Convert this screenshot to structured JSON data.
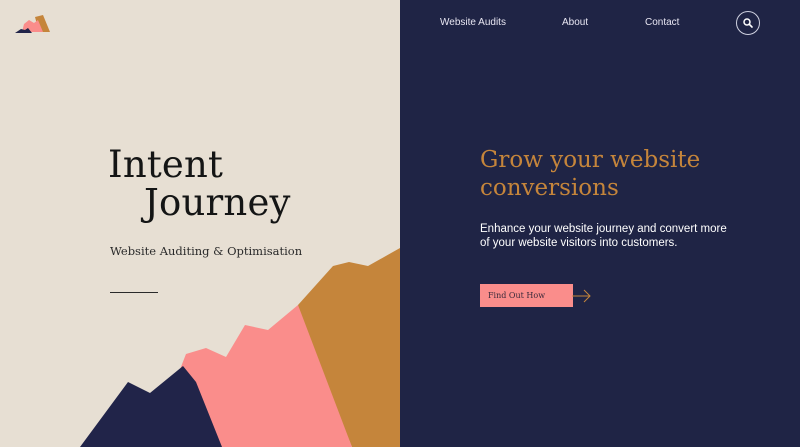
{
  "brand": {
    "title_line1": "Intent",
    "title_line2": "Journey",
    "subtitle": "Website Auditing & Optimisation",
    "logo_icon": "mountain-logo-icon"
  },
  "nav": {
    "items": [
      {
        "label": "Website Audits"
      },
      {
        "label": "About"
      },
      {
        "label": "Contact"
      }
    ],
    "search_icon": "search-icon"
  },
  "hero": {
    "headline": "Grow your website conversions",
    "description": "Enhance your website journey and convert more of your website visitors into customers.",
    "cta_label": "Find Out How",
    "cta_arrow_icon": "arrow-right-icon"
  },
  "colors": {
    "left_bg": "#e7dfd3",
    "right_bg": "#1f2445",
    "accent_gold": "#c5853b",
    "accent_pink": "#fa8d8b",
    "mountain_navy": "#212449"
  }
}
